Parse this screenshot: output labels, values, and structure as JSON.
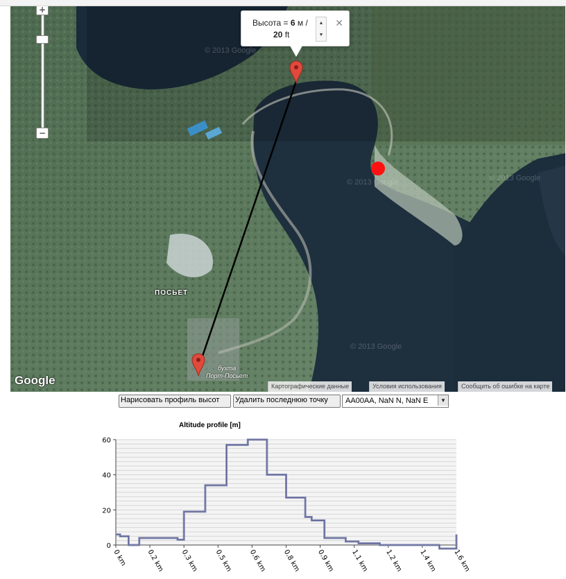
{
  "map": {
    "popup": {
      "label": "Высота = ",
      "meters": "6",
      "meters_unit": " м /",
      "feet": "20",
      "feet_unit": " ft",
      "close_label": "✕"
    },
    "zoom_in_label": "+",
    "zoom_out_label": "−",
    "place_label": "ПОСЬЕТ",
    "bay_label_1": "бухта",
    "bay_label_2": "Порт-Посьет",
    "google_logo": "Google",
    "watermark": "© 2013 Google",
    "attribution": {
      "map_data": "Картографические данные",
      "terms": "Условия использования",
      "report": "Сообщить об ошибке на карте"
    },
    "marker_icon": "map-pin-icon",
    "colors": {
      "marker": "#e0493c",
      "path_line": "#000000",
      "red_dot": "#ff1111",
      "water": "#1e2f3e"
    }
  },
  "controls": {
    "draw_profile_label": "Нарисовать профиль высот",
    "delete_point_label": "Удалить последнюю точку",
    "coord_select_value": "AA00AA, NaN N, NaN E"
  },
  "chart_data": {
    "type": "line",
    "title": "Altitude profile [m]",
    "xlabel": "",
    "ylabel": "",
    "x_tick_labels": [
      "0 km",
      "0.2 km",
      "0.3 km",
      "0.5 km",
      "0.6 km",
      "0.8 km",
      "0.9 km",
      "1.1 km",
      "1.2 km",
      "1.4 km",
      "1.6 km"
    ],
    "y_tick_labels": [
      "0",
      "20",
      "40",
      "60"
    ],
    "xlim": [
      0,
      1.6
    ],
    "ylim": [
      0,
      60
    ],
    "grid": true,
    "series_color": "#8a8fb8",
    "x": [
      0.0,
      0.02,
      0.06,
      0.11,
      0.29,
      0.32,
      0.42,
      0.52,
      0.62,
      0.71,
      0.8,
      0.89,
      0.92,
      0.98,
      1.08,
      1.14,
      1.24,
      1.34,
      1.52,
      1.6
    ],
    "values": [
      6,
      5,
      0,
      4,
      3,
      19,
      34,
      57,
      60,
      40,
      27,
      16,
      14,
      4,
      2,
      1,
      0,
      0,
      -2,
      6
    ]
  }
}
